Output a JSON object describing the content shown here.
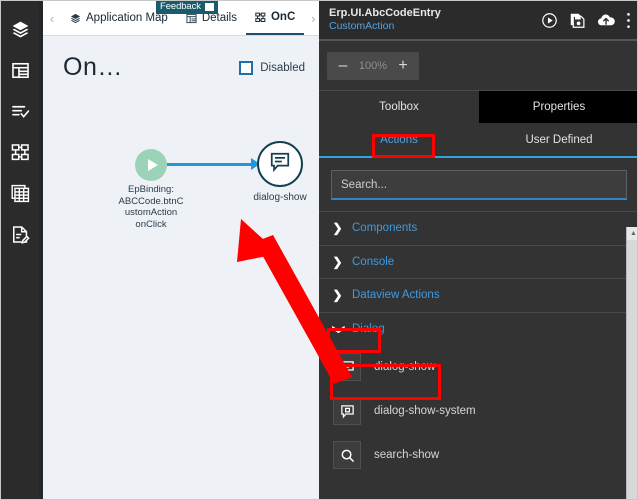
{
  "rail": {
    "items": [
      {
        "name": "layers-icon",
        "label": "Layers"
      },
      {
        "name": "layout-icon",
        "label": "Layout"
      },
      {
        "name": "checklist-icon",
        "label": "Checklist"
      },
      {
        "name": "sitemap-icon",
        "label": "Application Map"
      },
      {
        "name": "grid-icon",
        "label": "Grid"
      },
      {
        "name": "document-edit-icon",
        "label": "Document Edit"
      }
    ]
  },
  "left_panel": {
    "feedback": {
      "label": "Feedback",
      "icon": "flag-icon"
    },
    "tabs": {
      "prev_arrow": "‹",
      "next_arrow": "›",
      "items": [
        {
          "label": "Application Map",
          "icon": "layers-icon",
          "active": false
        },
        {
          "label": "Details",
          "icon": "details-icon",
          "active": false
        },
        {
          "label": "OnC",
          "icon": "sitemap-icon",
          "active": true
        }
      ]
    },
    "canvas": {
      "title": "On…",
      "disabled_label": "Disabled",
      "disabled_checked": false,
      "nodes": [
        {
          "name": "start-node",
          "label": "EpBinding:\nABCCode.btnC\nustomAction\nonClick",
          "label_lines": [
            "EpBinding:",
            "ABCCode.btnC",
            "ustomAction",
            "onClick"
          ],
          "icon": "play-icon",
          "color": "#9cd3b8"
        },
        {
          "name": "dialog-show-node",
          "label": "dialog-show",
          "icon": "dialog-icon",
          "color": "#13414f"
        }
      ],
      "link_color": "#2196de"
    }
  },
  "right_panel": {
    "header": {
      "title": "Erp.UI.AbcCodeEntry",
      "subtitle": "CustomAction",
      "actions": [
        {
          "name": "run-icon",
          "label": "Run"
        },
        {
          "name": "save-icon",
          "label": "Save"
        },
        {
          "name": "upload-cloud-icon",
          "label": "Deploy"
        },
        {
          "name": "more-vertical-icon",
          "label": "More"
        }
      ]
    },
    "zoom": {
      "minus_label": "–",
      "value": "100%",
      "plus_label": "+"
    },
    "primary_tabs": [
      {
        "label": "Toolbox",
        "active": true
      },
      {
        "label": "Properties",
        "active": false
      }
    ],
    "secondary_tabs": [
      {
        "label": "Actions",
        "active": true,
        "highlighted": true
      },
      {
        "label": "User Defined",
        "active": false,
        "highlighted": false
      }
    ],
    "search": {
      "placeholder": "Search...",
      "value": ""
    },
    "accordion": [
      {
        "label": "Components",
        "expanded": false,
        "highlighted": false
      },
      {
        "label": "Console",
        "expanded": false,
        "highlighted": false
      },
      {
        "label": "Dataview Actions",
        "expanded": false,
        "highlighted": false
      },
      {
        "label": "Dialog",
        "expanded": true,
        "highlighted": true
      }
    ],
    "dialog_items": [
      {
        "label": "dialog-show",
        "icon": "dialog-icon",
        "highlighted": true
      },
      {
        "label": "dialog-show-system",
        "icon": "dialog-system-icon",
        "highlighted": false
      },
      {
        "label": "search-show",
        "icon": "search-icon",
        "highlighted": false
      }
    ],
    "scrollbar": {
      "up_arrow": "▲"
    }
  },
  "annotation": {
    "color": "#ff0000",
    "arrow_name": "red-annotation-arrow",
    "boxes": [
      "actions-tab",
      "dialog-accordion",
      "dialog-show-item"
    ]
  }
}
